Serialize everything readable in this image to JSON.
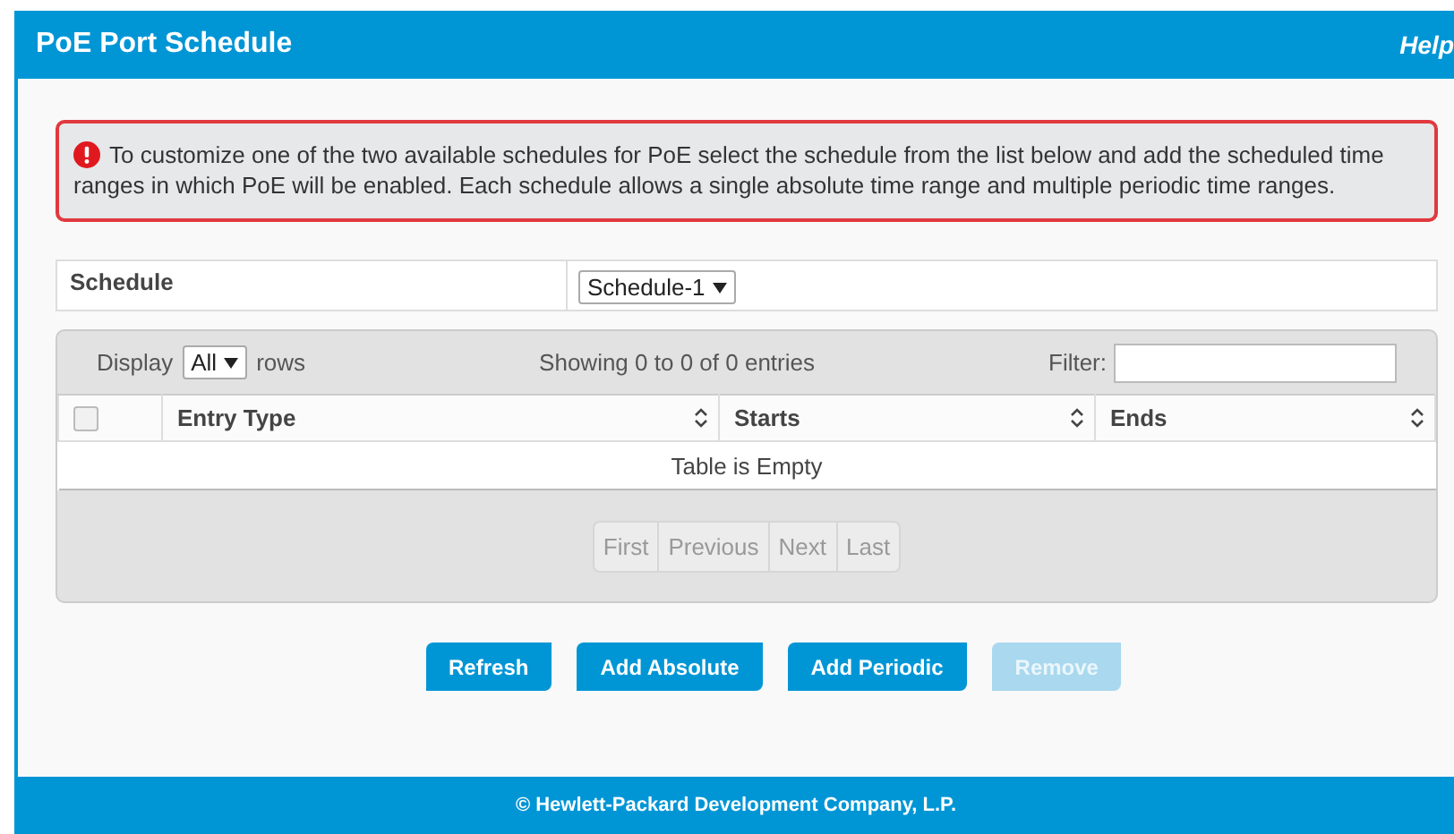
{
  "header": {
    "title": "PoE Port Schedule",
    "help": "Help"
  },
  "notice": {
    "text": "To customize one of the two available schedules for PoE select the schedule from the list below and add the scheduled time ranges in which PoE will be enabled. Each schedule allows a single absolute time range and multiple periodic time ranges."
  },
  "schedule": {
    "label": "Schedule",
    "value": "Schedule-1"
  },
  "table": {
    "display_label": "Display",
    "display_value": "All",
    "rows_label": "rows",
    "info": "Showing 0 to 0 of 0 entries",
    "filter_label": "Filter:",
    "select_all": {
      "checked": false
    },
    "columns": [
      "Entry Type",
      "Starts",
      "Ends"
    ],
    "empty": "Table is Empty",
    "pager": [
      {
        "label": "First",
        "disabled": true
      },
      {
        "label": "Previous",
        "disabled": true
      },
      {
        "label": "Next",
        "disabled": true
      },
      {
        "label": "Last",
        "disabled": true
      }
    ]
  },
  "buttons": [
    {
      "label": "Refresh",
      "disabled": false
    },
    {
      "label": "Add Absolute",
      "disabled": false
    },
    {
      "label": "Add Periodic",
      "disabled": false
    },
    {
      "label": "Remove",
      "disabled": true
    }
  ],
  "footer": "© Hewlett-Packard Development Company, L.P."
}
